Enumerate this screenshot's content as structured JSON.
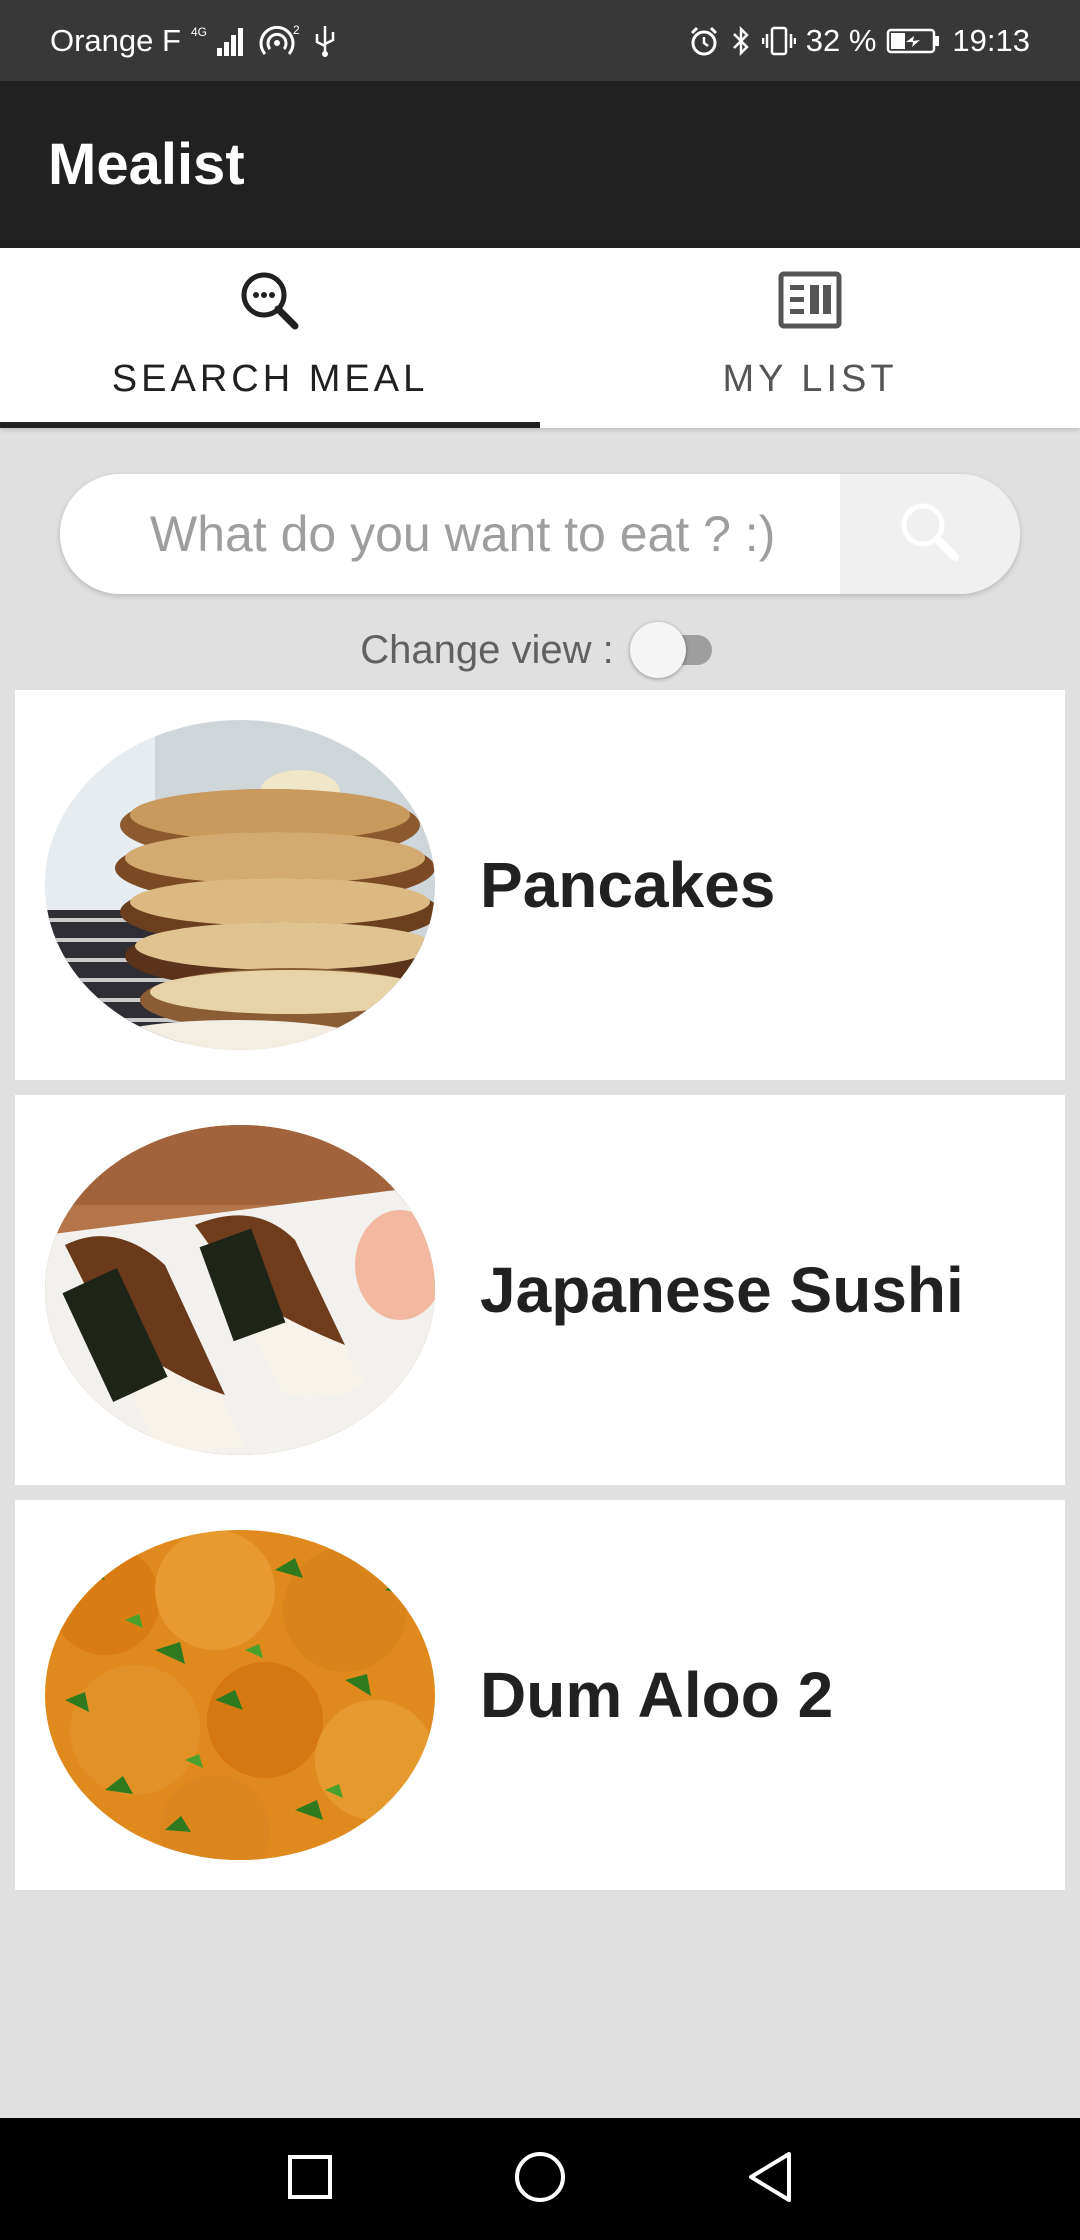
{
  "status_bar": {
    "carrier": "Orange F",
    "battery": "32 %",
    "time": "19:13",
    "icons": [
      "signal-icon",
      "hotspot-icon",
      "usb-icon",
      "alarm-icon",
      "bluetooth-icon",
      "vibrate-icon",
      "battery-icon"
    ]
  },
  "app_bar": {
    "title": "Mealist"
  },
  "tabs": [
    {
      "label": "SEARCH MEAL",
      "icon": "search-list-icon",
      "selected": true
    },
    {
      "label": "MY LIST",
      "icon": "list-view-icon",
      "selected": false
    }
  ],
  "search": {
    "placeholder": "What do you want to eat ? :)",
    "value": ""
  },
  "change_view": {
    "label": "Change view :",
    "enabled": false
  },
  "meals": [
    {
      "name": "Pancakes",
      "image": "pancakes-photo"
    },
    {
      "name": "Japanese Sushi",
      "image": "sushi-photo"
    },
    {
      "name": "Dum Aloo 2",
      "image": "dum-aloo-photo"
    }
  ],
  "nav_bar": {
    "buttons": [
      "recents-icon",
      "home-icon",
      "back-icon"
    ]
  },
  "colors": {
    "status_bar": "#383838",
    "app_bar": "#212121",
    "background": "#e0e0e0",
    "card": "#ffffff",
    "tab_indicator": "#212121",
    "nav_bar": "#000000"
  }
}
